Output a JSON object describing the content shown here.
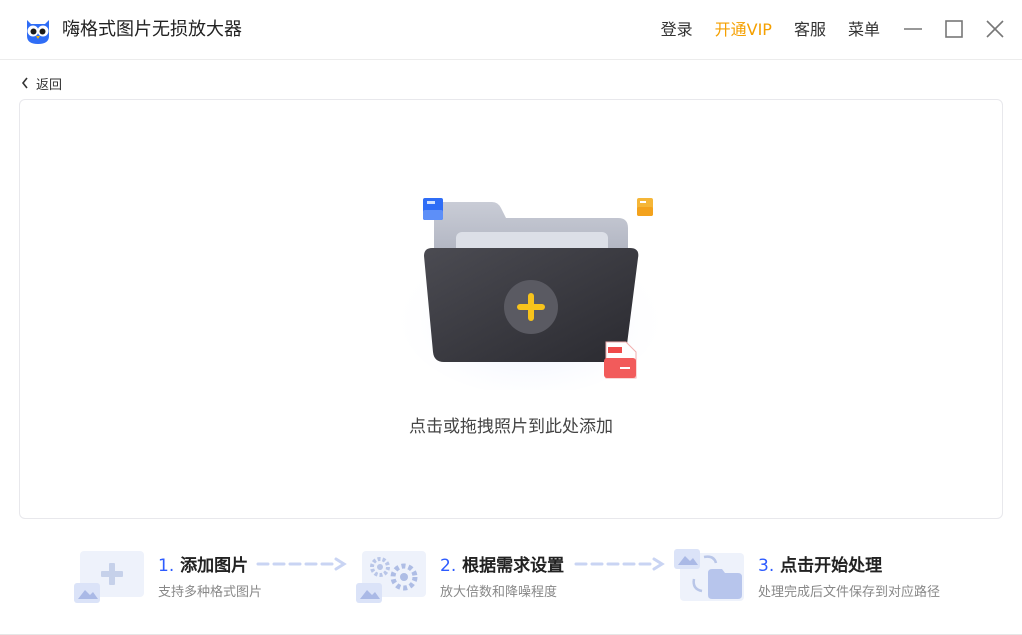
{
  "app": {
    "title": "嗨格式图片无损放大器"
  },
  "topnav": {
    "login": "登录",
    "vip": "开通VIP",
    "service": "客服",
    "menu": "菜单"
  },
  "back": {
    "label": "返回"
  },
  "dropzone": {
    "hint": "点击或拖拽照片到此处添加"
  },
  "steps": [
    {
      "num": "1.",
      "title": "添加图片",
      "desc": "支持多种格式图片"
    },
    {
      "num": "2.",
      "title": "根据需求设置",
      "desc": "放大倍数和降噪程度"
    },
    {
      "num": "3.",
      "title": "点击开始处理",
      "desc": "处理完成后文件保存到对应路径"
    }
  ],
  "colors": {
    "accent": "#2d5bff",
    "vip": "#f5a000",
    "plus": "#f7c31b"
  },
  "icons": [
    "owl-logo",
    "minimize-icon",
    "maximize-icon",
    "close-icon",
    "chevron-left-icon",
    "folder-icon",
    "plus-icon",
    "png-file-icon",
    "add-image-icon",
    "settings-gears-icon",
    "process-folder-icon"
  ]
}
